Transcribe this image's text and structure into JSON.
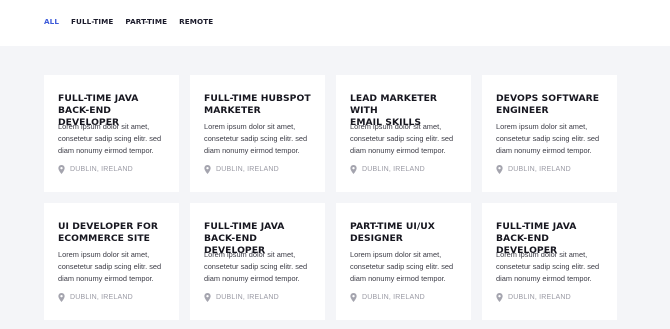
{
  "filters": [
    {
      "label": "ALL",
      "active": true
    },
    {
      "label": "FULL-TIME",
      "active": false
    },
    {
      "label": "PART-TIME",
      "active": false
    },
    {
      "label": "REMOTE",
      "active": false
    }
  ],
  "jobs": [
    {
      "title": "FULL-TIME JAVA\nBACK-END DEVELOPER",
      "description": "Lorem ipsum dolor sit amet,\nconsetetur sadip scing elitr. sed\ndiam nonumy eirmod tempor.",
      "location": "DUBLIN, IRELAND"
    },
    {
      "title": "FULL-TIME HUBSPOT\nMARKETER",
      "description": "Lorem ipsum dolor sit amet,\nconsetetur sadip scing elitr. sed\ndiam nonumy eirmod tempor.",
      "location": "DUBLIN, IRELAND"
    },
    {
      "title": "LEAD MARKETER WITH\nEMAIL SKILLS",
      "description": "Lorem ipsum dolor sit amet,\nconsetetur sadip scing elitr. sed\ndiam nonumy eirmod tempor.",
      "location": "DUBLIN, IRELAND"
    },
    {
      "title": "DEVOPS SOFTWARE\nENGINEER",
      "description": "Lorem ipsum dolor sit amet,\nconsetetur sadip scing elitr. sed\ndiam nonumy eirmod tempor.",
      "location": "DUBLIN, IRELAND"
    },
    {
      "title": "UI DEVELOPER FOR\nECOMMERCE SITE",
      "description": "Lorem ipsum dolor sit amet,\nconsetetur sadip scing elitr. sed\ndiam nonumy eirmod tempor.",
      "location": "DUBLIN, IRELAND"
    },
    {
      "title": "FULL-TIME JAVA\nBACK-END DEVELOPER",
      "description": "Lorem ipsum dolor sit amet,\nconsetetur sadip scing elitr. sed\ndiam nonumy eirmod tempor.",
      "location": "DUBLIN, IRELAND"
    },
    {
      "title": "PART-TIME UI/UX\nDESIGNER",
      "description": "Lorem ipsum dolor sit amet,\nconsetetur sadip scing elitr. sed\ndiam nonumy eirmod tempor.",
      "location": "DUBLIN, IRELAND"
    },
    {
      "title": "FULL-TIME JAVA\nBACK-END DEVELOPER",
      "description": "Lorem ipsum dolor sit amet,\nconsetetur sadip scing elitr. sed\ndiam nonumy eirmod tempor.",
      "location": "DUBLIN, IRELAND"
    }
  ],
  "colors": {
    "accent": "#3d5bd9",
    "background": "#f4f5f8",
    "card": "#ffffff",
    "muted": "#9a9aa4"
  },
  "icons": {
    "location": "map-pin-icon"
  }
}
